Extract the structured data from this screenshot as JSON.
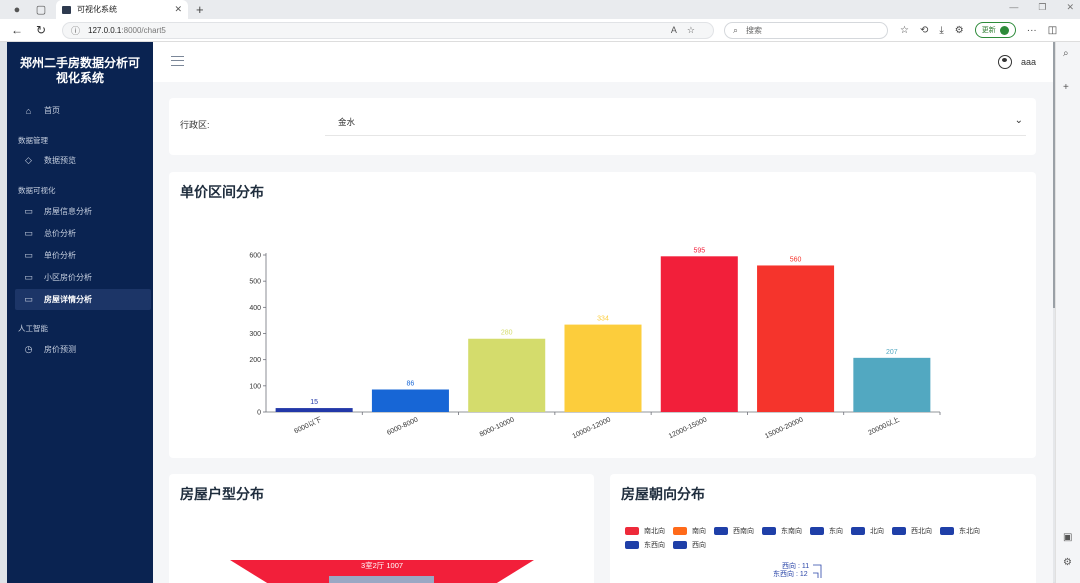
{
  "browser": {
    "tab_title": "可视化系统",
    "url_host": "127.0.0.1",
    "url_path": ":8000/chart5",
    "search_placeholder": "搜索",
    "update_label": "更新"
  },
  "sidebar": {
    "brand": "郑州二手房数据分析可视化系统",
    "home": "首页",
    "groups": [
      {
        "label": "数据管理",
        "items": [
          "数据预览"
        ]
      },
      {
        "label": "数据可视化",
        "items": [
          "房屋信息分析",
          "总价分析",
          "单价分析",
          "小区房价分析",
          "房屋详情分析"
        ]
      },
      {
        "label": "人工智能",
        "items": [
          "房价预测"
        ]
      }
    ],
    "active_item": "房屋详情分析"
  },
  "header": {
    "username": "aaa"
  },
  "filter": {
    "label": "行政区:",
    "selected": "金水"
  },
  "price_chart": {
    "title": "单价区间分布"
  },
  "type_chart": {
    "title": "房屋户型分布",
    "top_label": "3室2厅",
    "top_value": "1007"
  },
  "orient_chart": {
    "title": "房屋朝向分布",
    "legend": [
      {
        "name": "南北向",
        "color": "#ee2a3a"
      },
      {
        "name": "南向",
        "color": "#ff6a1a"
      },
      {
        "name": "西南向",
        "color": "#1f3fa8"
      },
      {
        "name": "东南向",
        "color": "#1f3fa8"
      },
      {
        "name": "东向",
        "color": "#1f3fa8"
      },
      {
        "name": "北向",
        "color": "#1f3fa8"
      },
      {
        "name": "西北向",
        "color": "#1f3fa8"
      },
      {
        "name": "东北向",
        "color": "#1f3fa8"
      },
      {
        "name": "东西向",
        "color": "#1f3fa8"
      },
      {
        "name": "西向",
        "color": "#1f3fa8"
      }
    ],
    "visible_labels": [
      "西向 : 11",
      "东西向 : 12"
    ]
  },
  "chart_data": [
    {
      "type": "bar",
      "title": "单价区间分布",
      "categories": [
        "6000以下",
        "6000-8000",
        "8000-10000",
        "10000-12000",
        "12000-15000",
        "15000-20000",
        "20000以上"
      ],
      "values": [
        15,
        86,
        280,
        334,
        595,
        560,
        207
      ],
      "colors": [
        "#2238a8",
        "#1766d6",
        "#d4dc6c",
        "#fccd3c",
        "#f21f3a",
        "#f5342c",
        "#52a8c1"
      ],
      "ylim": [
        0,
        600
      ],
      "yticks": [
        0,
        100,
        200,
        300,
        400,
        500,
        600
      ],
      "grid": false,
      "data_labels": true
    },
    {
      "type": "funnel",
      "title": "房屋户型分布",
      "categories": [
        "3室2厅"
      ],
      "values": [
        1007
      ]
    }
  ]
}
